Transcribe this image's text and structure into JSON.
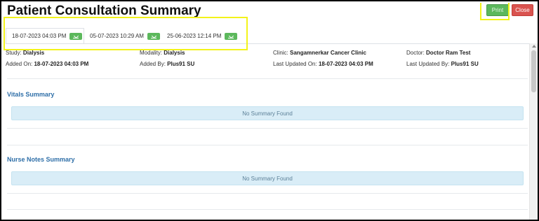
{
  "header": {
    "title": "Patient Consultation Summary",
    "print_label": "Print",
    "close_label": "Close"
  },
  "tabs": [
    {
      "label": "18-07-2023 04:03 PM",
      "active": true
    },
    {
      "label": "05-07-2023 10:29 AM",
      "active": false
    },
    {
      "label": "25-06-2023 12:14 PM",
      "active": false
    }
  ],
  "details": {
    "study_label": "Study:",
    "study": "Dialysis",
    "modality_label": "Modality:",
    "modality": "Dialysis",
    "clinic_label": "Clinic:",
    "clinic": "Sangamnerkar Cancer Clinic",
    "doctor_label": "Doctor:",
    "doctor": "Doctor Ram Test",
    "added_on_label": "Added On:",
    "added_on": "18-07-2023 04:03 PM",
    "added_by_label": "Added By:",
    "added_by": "Plus91 SU",
    "last_updated_on_label": "Last Updated On:",
    "last_updated_on": "18-07-2023 04:03 PM",
    "last_updated_by_label": "Last Updated By:",
    "last_updated_by": "Plus91 SU"
  },
  "sections": {
    "vitals": {
      "title": "Vitals Summary",
      "empty": "No Summary Found"
    },
    "nurse_notes": {
      "title": "Nurse Notes Summary",
      "empty": "No Summary Found"
    }
  },
  "colors": {
    "highlight": "#f3f31a",
    "print": "#5cb85c",
    "close": "#d9534f",
    "section_title": "#2f6fa8",
    "info_box": "#d9edf7"
  }
}
